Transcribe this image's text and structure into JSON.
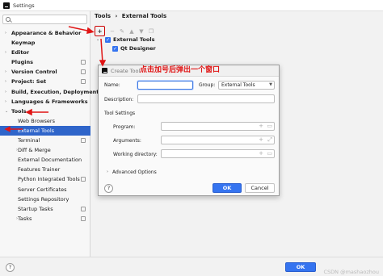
{
  "window": {
    "title": "Settings"
  },
  "search": {
    "placeholder": ""
  },
  "sidebar": {
    "items": [
      {
        "label": "Appearance & Behavior",
        "arrow": "›",
        "bold": true,
        "level": 0
      },
      {
        "label": "Keymap",
        "arrow": "",
        "bold": true,
        "level": 0
      },
      {
        "label": "Editor",
        "arrow": "›",
        "bold": true,
        "level": 0
      },
      {
        "label": "Plugins",
        "arrow": "",
        "bold": true,
        "level": 0,
        "proj": true
      },
      {
        "label": "Version Control",
        "arrow": "›",
        "bold": true,
        "level": 0,
        "proj": true
      },
      {
        "label": "Project: Set",
        "arrow": "›",
        "bold": true,
        "level": 0,
        "proj": true
      },
      {
        "label": "Build, Execution, Deployment",
        "arrow": "›",
        "bold": true,
        "level": 0
      },
      {
        "label": "Languages & Frameworks",
        "arrow": "›",
        "bold": true,
        "level": 0
      },
      {
        "label": "Tools",
        "arrow": "⌄",
        "bold": true,
        "level": 0
      },
      {
        "label": "Web Browsers",
        "arrow": "",
        "bold": false,
        "level": 1
      },
      {
        "label": "External Tools",
        "arrow": "",
        "bold": false,
        "level": 1,
        "selected": true
      },
      {
        "label": "Terminal",
        "arrow": "",
        "bold": false,
        "level": 1,
        "proj": true
      },
      {
        "label": "Diff & Merge",
        "arrow": "›",
        "bold": false,
        "level": 1
      },
      {
        "label": "External Documentation",
        "arrow": "",
        "bold": false,
        "level": 1
      },
      {
        "label": "Features Trainer",
        "arrow": "",
        "bold": false,
        "level": 1
      },
      {
        "label": "Python Integrated Tools",
        "arrow": "",
        "bold": false,
        "level": 1,
        "proj": true
      },
      {
        "label": "Server Certificates",
        "arrow": "",
        "bold": false,
        "level": 1
      },
      {
        "label": "Settings Repository",
        "arrow": "",
        "bold": false,
        "level": 1
      },
      {
        "label": "Startup Tasks",
        "arrow": "",
        "bold": false,
        "level": 1,
        "proj": true
      },
      {
        "label": "Tasks",
        "arrow": "›",
        "bold": false,
        "level": 1,
        "proj": true
      }
    ]
  },
  "breadcrumb": {
    "root": "Tools",
    "sep": "›",
    "current": "External Tools"
  },
  "toolbar": {
    "add": "+",
    "remove": "−",
    "edit": "✎",
    "up": "▲",
    "down": "▼",
    "copy": "❐"
  },
  "tools_tree": {
    "group": {
      "arrow": "⌄",
      "label": "External Tools",
      "checked": "✓"
    },
    "child": {
      "label": "Qt Designer",
      "checked": "✓"
    }
  },
  "annotation": "点击加号后弹出一个窗口",
  "dialog": {
    "title": "Create Tool",
    "name_label": "Name:",
    "name_value": "",
    "group_label": "Group:",
    "group_value": "External Tools",
    "description_label": "Description:",
    "description_value": "",
    "tool_settings": "Tool Settings",
    "program_label": "Program:",
    "arguments_label": "Arguments:",
    "workdir_label": "Working directory:",
    "advanced_label": "Advanced Options",
    "advanced_arrow": "›",
    "help": "?",
    "ok": "OK",
    "cancel": "Cancel"
  },
  "bottom": {
    "help": "?",
    "ok": "OK",
    "watermark": "CSDN @mashaozhou"
  },
  "colors": {
    "accent": "#3574f0",
    "selected": "#2f65ca",
    "annotation": "#e01515"
  }
}
